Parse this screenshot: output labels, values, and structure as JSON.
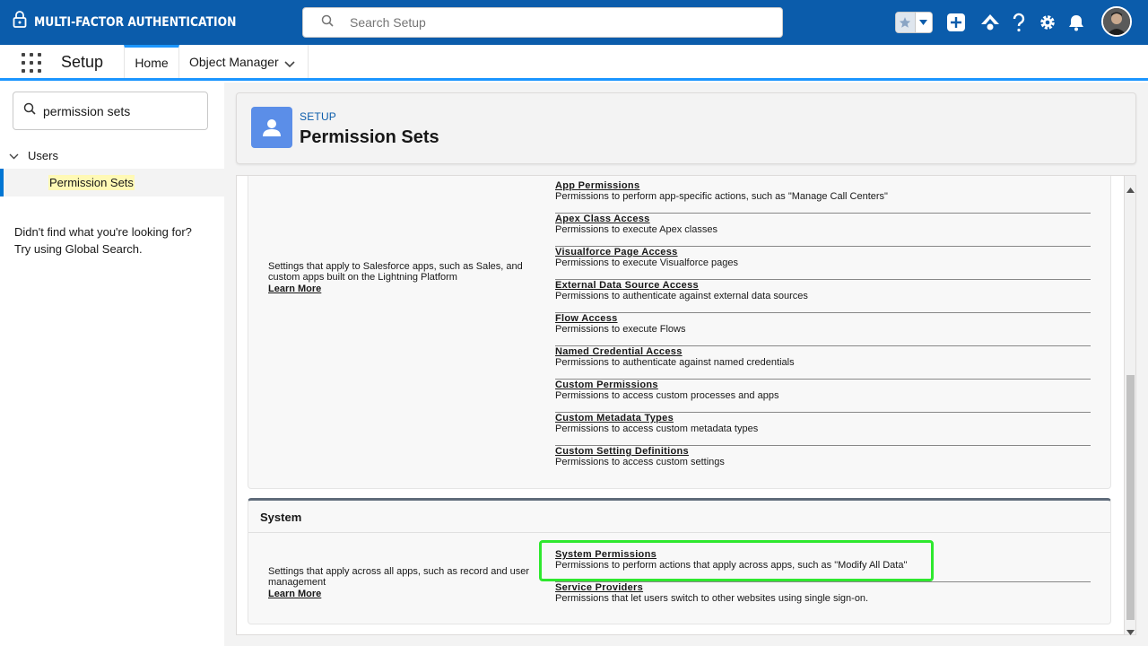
{
  "header": {
    "app_title": "MULTI-FACTOR AUTHENTICATION",
    "search_placeholder": "Search Setup",
    "colors": {
      "brand": "#0b5cab",
      "accent": "#1b96ff"
    }
  },
  "nav": {
    "app_name": "Setup",
    "tabs": [
      {
        "label": "Home"
      },
      {
        "label": "Object Manager"
      }
    ]
  },
  "sidebar": {
    "quick_find_value": "permission sets",
    "tree": {
      "group": "Users",
      "item": "Permission Sets"
    },
    "not_found_line1": "Didn't find what you're looking for?",
    "not_found_line2": "Try using Global Search."
  },
  "page_header": {
    "eyebrow": "SETUP",
    "title": "Permission Sets"
  },
  "apps_section": {
    "description": "Settings that apply to Salesforce apps, such as Sales, and custom apps built on the Lightning Platform",
    "learn_more": "Learn More",
    "items": [
      {
        "title": "App Permissions",
        "desc": "Permissions to perform app-specific actions, such as \"Manage Call Centers\""
      },
      {
        "title": "Apex Class Access",
        "desc": "Permissions to execute Apex classes"
      },
      {
        "title": "Visualforce Page Access",
        "desc": "Permissions to execute Visualforce pages"
      },
      {
        "title": "External Data Source Access",
        "desc": "Permissions to authenticate against external data sources"
      },
      {
        "title": "Flow Access",
        "desc": "Permissions to execute Flows"
      },
      {
        "title": "Named Credential Access",
        "desc": "Permissions to authenticate against named credentials"
      },
      {
        "title": "Custom Permissions",
        "desc": "Permissions to access custom processes and apps"
      },
      {
        "title": "Custom Metadata Types",
        "desc": "Permissions to access custom metadata types"
      },
      {
        "title": "Custom Setting Definitions",
        "desc": "Permissions to access custom settings"
      }
    ]
  },
  "system_section": {
    "title": "System",
    "description": "Settings that apply across all apps, such as record and user management",
    "learn_more": "Learn More",
    "items": [
      {
        "title": "System Permissions",
        "desc": "Permissions to perform actions that apply across apps, such as \"Modify All Data\""
      },
      {
        "title": "Service Providers",
        "desc": "Permissions that let users switch to other websites using single sign-on."
      }
    ],
    "highlight_color": "#2ee82e"
  }
}
